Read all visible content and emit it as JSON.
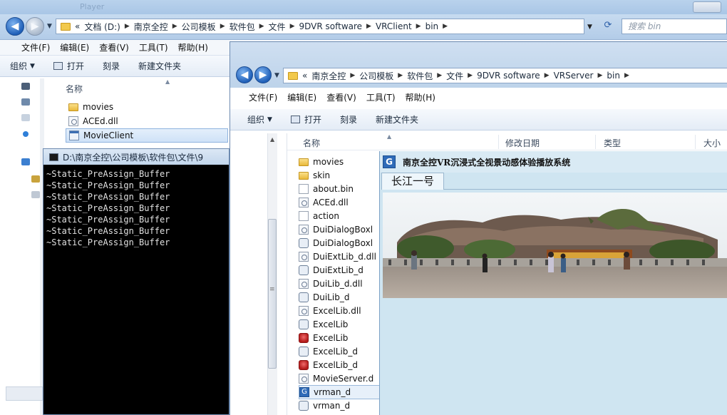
{
  "back_window": {
    "title_ghost": "Player",
    "breadcrumb": [
      "«",
      "文档 (D:)",
      "南京全控",
      "公司模板",
      "软件包",
      "文件",
      "9DVR software",
      "VRClient",
      "bin"
    ],
    "search_placeholder": "搜索 bin",
    "menu": [
      "文件(F)",
      "编辑(E)",
      "查看(V)",
      "工具(T)",
      "帮助(H)"
    ],
    "toolbar": {
      "organize": "组织",
      "open": "打开",
      "burn": "刻录",
      "new_folder": "新建文件夹"
    },
    "column_name": "名称",
    "files": [
      {
        "name": "movies",
        "type": "folder"
      },
      {
        "name": "ACEd.dll",
        "type": "dll"
      },
      {
        "name": "MovieClient",
        "type": "exe"
      }
    ]
  },
  "console": {
    "title": "D:\\南京全控\\公司模板\\软件包\\文件\\9",
    "lines": [
      "~Static_PreAssign_Buffer",
      "~Static_PreAssign_Buffer",
      "~Static_PreAssign_Buffer",
      "~Static_PreAssign_Buffer",
      "~Static_PreAssign_Buffer",
      "~Static_PreAssign_Buffer",
      "~Static_PreAssign_Buffer"
    ]
  },
  "front_window": {
    "breadcrumb": [
      "«",
      "南京全控",
      "公司模板",
      "软件包",
      "文件",
      "9DVR software",
      "VRServer",
      "bin"
    ],
    "menu": [
      "文件(F)",
      "编辑(E)",
      "查看(V)",
      "工具(T)",
      "帮助(H)"
    ],
    "toolbar": {
      "organize": "组织",
      "open": "打开",
      "burn": "刻录",
      "new_folder": "新建文件夹"
    },
    "columns": {
      "name": "名称",
      "modified": "修改日期",
      "type": "类型",
      "size": "大小"
    },
    "files": [
      {
        "name": "movies",
        "type": "folder"
      },
      {
        "name": "skin",
        "type": "folder"
      },
      {
        "name": "about.bin",
        "type": "blank"
      },
      {
        "name": "ACEd.dll",
        "type": "dll"
      },
      {
        "name": "action",
        "type": "blank"
      },
      {
        "name": "DuiDialogBoxl",
        "type": "dll"
      },
      {
        "name": "DuiDialogBoxl",
        "type": "cfg"
      },
      {
        "name": "DuiExtLib_d.dll",
        "type": "dll"
      },
      {
        "name": "DuiExtLib_d",
        "type": "cfg"
      },
      {
        "name": "DuiLib_d.dll",
        "type": "dll"
      },
      {
        "name": "DuiLib_d",
        "type": "cfg"
      },
      {
        "name": "ExcelLib.dll",
        "type": "dll"
      },
      {
        "name": "ExcelLib",
        "type": "cfg"
      },
      {
        "name": "ExcelLib",
        "type": "red"
      },
      {
        "name": "ExcelLib_d",
        "type": "cfg"
      },
      {
        "name": "ExcelLib_d",
        "type": "red"
      },
      {
        "name": "MovieServer.d",
        "type": "dll"
      },
      {
        "name": "vrman_d",
        "type": "app"
      },
      {
        "name": "vrman_d",
        "type": "cfg"
      }
    ]
  },
  "vr_app": {
    "title": "南京全控VR沉浸式全视景动感体验播放系统",
    "icon_letter": "G",
    "tab_label": "长江一号"
  }
}
